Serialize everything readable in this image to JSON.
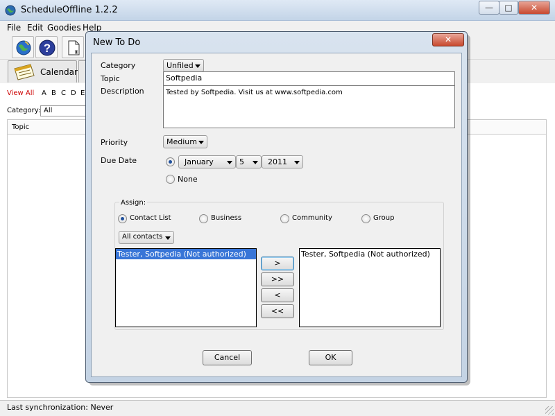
{
  "app": {
    "title": "ScheduleOffline 1.2.2"
  },
  "window_controls": {
    "minimize": "—",
    "maximize": "□",
    "close": "✕"
  },
  "menu": {
    "items": [
      "File",
      "Edit",
      "Goodies",
      "Help"
    ]
  },
  "toolbar": {
    "icons": [
      "globe-icon",
      "help-icon",
      "new-document-icon"
    ]
  },
  "tabs": {
    "calendar": "Calendar"
  },
  "filter": {
    "view_all": "View All",
    "letters": [
      "A",
      "B",
      "C",
      "D",
      "E"
    ],
    "category_label": "Category:",
    "category_value": "All"
  },
  "list": {
    "topic_header": "Topic"
  },
  "status": {
    "text": "Last synchronization: Never"
  },
  "dialog": {
    "title": "New To Do",
    "close": "✕",
    "category_label": "Category",
    "category_value": "Unfiled",
    "topic_label": "Topic",
    "topic_value": "Softpedia",
    "description_label": "Description",
    "description_value": "Tested by Softpedia. Visit us at www.softpedia.com",
    "priority_label": "Priority",
    "priority_value": "Medium",
    "due_label": "Due Date",
    "due_month": "January",
    "due_day": "5",
    "due_year": "2011",
    "none_label": "None",
    "assign": {
      "legend": "Assign:",
      "options": [
        "Contact List",
        "Business",
        "Community",
        "Group"
      ],
      "selected": "Contact List",
      "contacts_value": "All contacts",
      "available": [
        "Tester, Softpedia  (Not authorized)"
      ],
      "assigned": [
        "Tester, Softpedia  (Not authorized)"
      ],
      "buttons": {
        "add": ">",
        "add_all": ">>",
        "remove": "<",
        "remove_all": "<<"
      }
    },
    "cancel_label": "Cancel",
    "ok_label": "OK"
  },
  "colors": {
    "view_all": "#cc0000",
    "selection": "#3875d7",
    "title_bar": "#c3d4e7",
    "close_button": "#c8492f"
  }
}
